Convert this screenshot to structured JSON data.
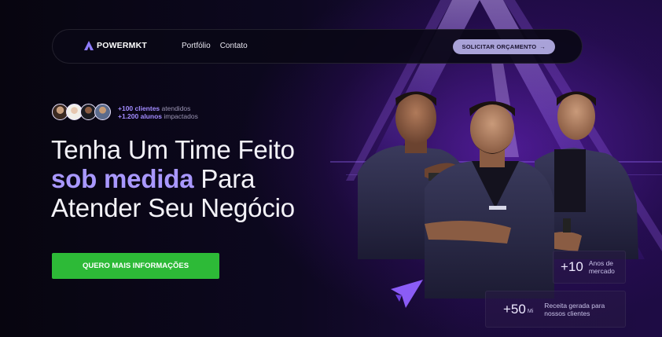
{
  "brand": {
    "name": "POWERMKT",
    "accent": "#8b5cf6",
    "cta_green": "#2dba37"
  },
  "nav": {
    "links": [
      {
        "label": "Portfólio"
      },
      {
        "label": "Contato"
      }
    ],
    "cta_label": "SOLICITAR ORÇAMENTO",
    "cta_arrow": "→"
  },
  "social_proof": {
    "avatar_count": 4,
    "line1_strong": "+100 clientes",
    "line1_rest": " atendidos",
    "line2_strong": "+1.200 alunos",
    "line2_rest": " impactados"
  },
  "headline": {
    "line1": "Tenha Um Time Feito",
    "accent": "sob medida",
    "line2_rest": " Para",
    "line3": "Atender Seu Negócio"
  },
  "cta_main": {
    "label": "QUERO MAIS INFORMAÇÕES"
  },
  "stats": [
    {
      "value": "+10",
      "suffix": "",
      "label_line1": "Anos de",
      "label_line2": "mercado"
    },
    {
      "value": "+50",
      "suffix": "Mi",
      "label_line1": "Receita gerada para",
      "label_line2": "nossos clientes"
    }
  ],
  "icons": {
    "logo": "powermkt-logo-icon",
    "arrow": "arrow-right-icon",
    "decor": "paper-plane-icon"
  }
}
